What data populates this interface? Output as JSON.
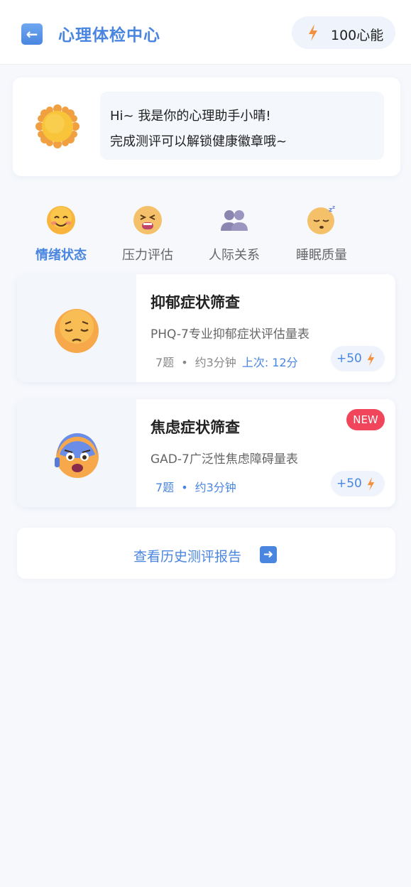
{
  "header": {
    "back_icon": "arrow-left-icon",
    "title": "心理体检中心",
    "points": "100心能",
    "points_icon": "lightning-icon"
  },
  "greeting": {
    "avatar_icon": "sun-icon",
    "line1": "Hi~ 我是你的心理助手小晴!",
    "line2": "完成测评可以解锁健康徽章哦~"
  },
  "tabs": [
    {
      "label": "情绪状态",
      "icon": "smiling-face-icon",
      "active": true
    },
    {
      "label": "压力评估",
      "icon": "tired-face-icon",
      "active": false
    },
    {
      "label": "人际关系",
      "icon": "people-icon",
      "active": false
    },
    {
      "label": "睡眠质量",
      "icon": "sleeping-face-icon",
      "active": false
    }
  ],
  "cards": [
    {
      "title": "抑郁症状筛查",
      "description": "PHQ-7专业抑郁症状评估量表",
      "questions": "7题",
      "duration": "约3分钟",
      "last": "上次: 12分",
      "reward": "+50",
      "icon": "pensive-face-icon"
    },
    {
      "title": "焦虑症状筛查",
      "badge": "NEW",
      "description": "GAD-7广泛性焦虑障碍量表",
      "questions": "7题",
      "duration": "约3分钟",
      "reward": "+50",
      "icon": "anxious-face-icon"
    }
  ],
  "history": {
    "label": "查看历史测评报告",
    "icon": "arrow-right-icon"
  },
  "colors": {
    "accent": "#4a86e0",
    "background": "#f6f8fc",
    "badge": "#f0455a",
    "bolt": "#f39040"
  }
}
